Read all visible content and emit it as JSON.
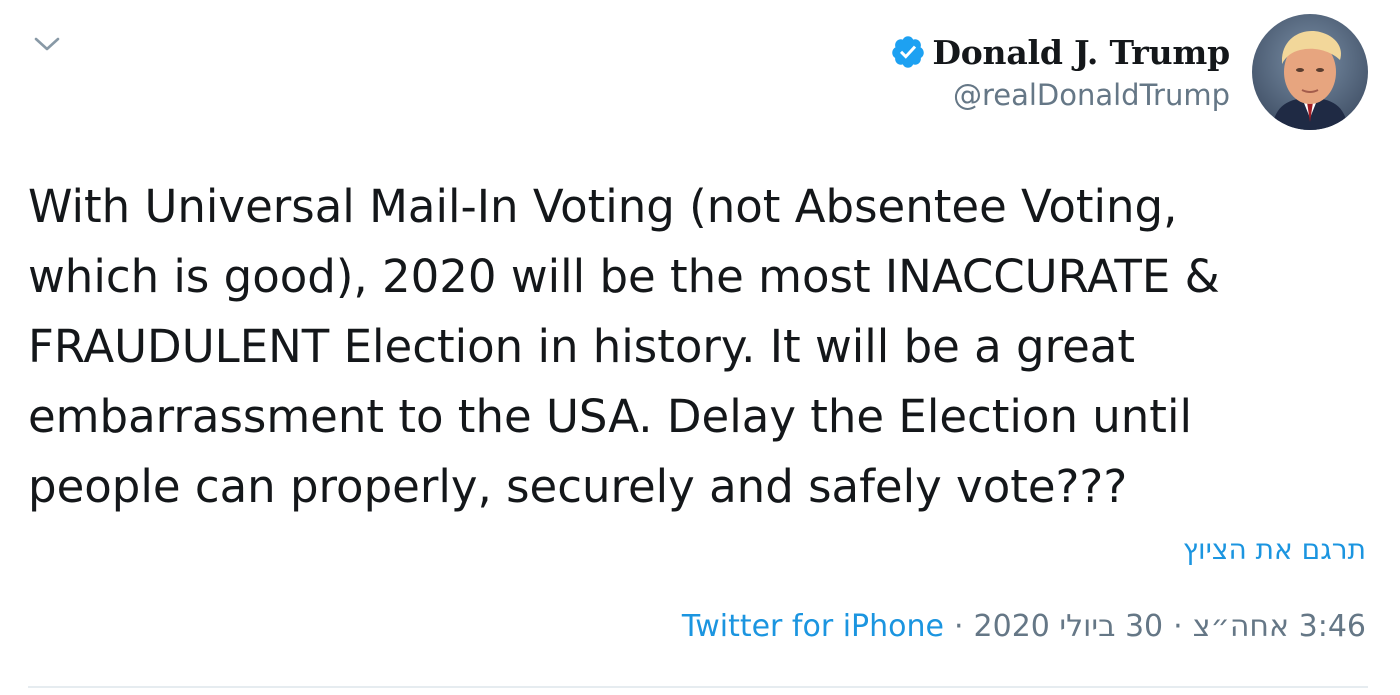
{
  "tweet": {
    "author": {
      "display_name": "Donald J. Trump",
      "handle": "@realDonaldTrump",
      "verified": true
    },
    "text": "With Universal Mail-In Voting (not Absentee Voting,\nwhich is good), 2020 will be the most INACCURATE &\nFRAUDULENT Election in history. It will be a great\nembarrassment to the USA. Delay the Election until\npeople can properly, securely and safely vote???",
    "translate_label": "תרגם את הציוץ",
    "time": "3:46 אחה״צ",
    "date": "30 ביולי 2020",
    "source": "Twitter for iPhone",
    "separator": "·"
  },
  "icons": {
    "menu": "chevron-down-icon",
    "verified": "verified-badge-icon"
  },
  "colors": {
    "link": "#1b95e0",
    "secondary_text": "#657786",
    "verified": "#1da1f2",
    "divider": "#e6ecf0"
  }
}
